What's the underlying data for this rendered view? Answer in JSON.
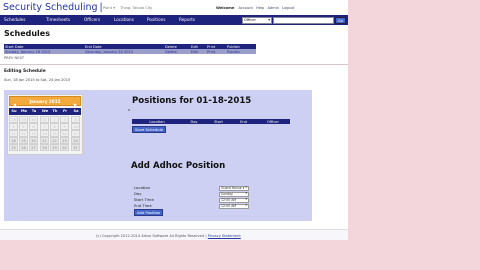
{
  "app": {
    "title": "Security Scheduling",
    "title_sep": "|",
    "context_a": "Plant ▾",
    "context_b": "Thing: Tabula City"
  },
  "topnav": {
    "welcome": "Welcome",
    "links": [
      "Account",
      "Help",
      "Admin",
      "Logout"
    ]
  },
  "nav": {
    "items": [
      "Schedules",
      "Timesheets",
      "Officers",
      "Locations",
      "Positions",
      "Reports"
    ],
    "select_value": "Officer",
    "search_placeholder": "",
    "go_label": "Go"
  },
  "schedules": {
    "title": "Schedules",
    "columns": [
      "Start Date",
      "End Date",
      "Delete",
      "Edit",
      "Print",
      "Publish"
    ],
    "rows": [
      [
        "Sunday, January 18 2015",
        "Saturday, January 24 2015",
        "Delete",
        "Edit",
        "Print",
        "Publish"
      ]
    ],
    "prev_next": "PREV NEXT"
  },
  "edit": {
    "title": "Editing Schedule",
    "range": "Sun, 18 Jan 2015 to Sat, 24 Jan 2015"
  },
  "calendar": {
    "month": "January 2015",
    "prev": "◀",
    "next": "▶",
    "days": [
      "Su",
      "Mo",
      "Tu",
      "We",
      "Th",
      "Fr",
      "Sa"
    ],
    "weeks": [
      [
        "28",
        "29",
        "30",
        "31",
        "1",
        "2",
        "3"
      ],
      [
        "4",
        "5",
        "6",
        "7",
        "8",
        "9",
        "10"
      ],
      [
        "11",
        "12",
        "13",
        "14",
        "15",
        "16",
        "17"
      ],
      [
        "18",
        "19",
        "20",
        "21",
        "22",
        "23",
        "24"
      ],
      [
        "25",
        "26",
        "27",
        "28",
        "29",
        "30",
        "31"
      ]
    ]
  },
  "positions": {
    "title": "Positions for 01-18-2015",
    "marker": "x",
    "columns": [
      "Location",
      "Day",
      "Start",
      "End",
      "Officer"
    ],
    "save_label": "Save Schedule"
  },
  "adhoc": {
    "title": "Add Adhoc Position",
    "fields": [
      {
        "label": "Location",
        "value": "Guard House ▾"
      },
      {
        "label": "Day",
        "value": "Sunday"
      },
      {
        "label": "Start Time",
        "value": "12:00 AM"
      },
      {
        "label": "End Time",
        "value": "12:00 AM"
      }
    ],
    "add_label": "Add Position"
  },
  "footer": {
    "text": "(c) Copyright 2012-2014 Arbor Software All Rights Reserved |",
    "privacy": "Privacy Statement"
  },
  "colors": {
    "navbar": "#1e237e",
    "accent_button": "#4466cc",
    "panel": "#cdd0f3",
    "calendar_header": "#f3a93b",
    "background": "#f3d6dc"
  }
}
